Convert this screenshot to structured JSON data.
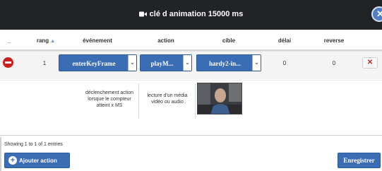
{
  "dialog": {
    "title": "clé d animation 15000 ms",
    "close_glyph": "✕"
  },
  "table": {
    "columns": {
      "remove": "_",
      "rang": "rang",
      "evenement": "événement",
      "action": "action",
      "cible": "cible",
      "delai": "délai",
      "reverse": "reverse"
    },
    "sort_glyph": "▲",
    "rows": [
      {
        "rang": "1",
        "evenement": "enterKeyFrame",
        "action": "playM...",
        "cible": "hardy2-in...",
        "delai": "0",
        "reverse": "0",
        "delete_glyph": "✕",
        "caret_glyph": "⌄",
        "detail": {
          "evenement_desc": "déclenchement action lorsque le compteur atteint x MS",
          "action_desc": "lecture d'un média vidéo ou audio"
        }
      }
    ]
  },
  "footer": {
    "entries_text": "Showing 1 to 1 of 1 entries",
    "add_label": "Ajouter action",
    "add_glyph": "+",
    "save_label": "Enregistrer"
  },
  "colors": {
    "header_bg": "#222326",
    "primary": "#3b6db5",
    "danger": "#cd1f1f"
  },
  "icons": {
    "title": "video-camera-icon",
    "close": "close-circle-icon",
    "remove_row": "minus-circle-icon",
    "delete": "times-icon",
    "add": "plus-circle-icon",
    "dropdown": "chevron-down-icon"
  }
}
